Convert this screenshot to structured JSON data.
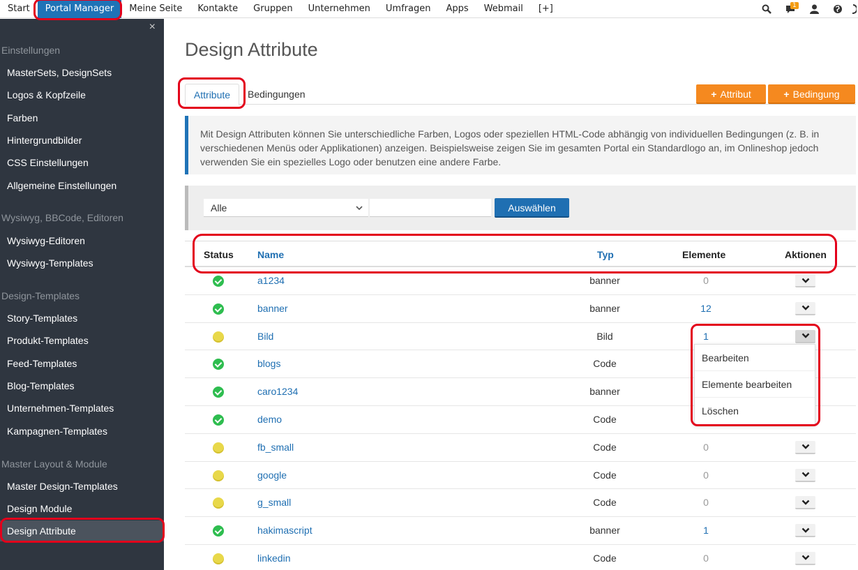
{
  "topnav": {
    "items": [
      "Start",
      "Portal Manager",
      "Meine Seite",
      "Kontakte",
      "Gruppen",
      "Unternehmen",
      "Umfragen",
      "Apps",
      "Webmail",
      "[+]"
    ],
    "active_index": 1,
    "notification_count": "1",
    "icons": [
      "search-icon",
      "chat-icon",
      "user-icon",
      "globe-icon",
      "power-icon"
    ]
  },
  "sidebar": {
    "close_label": "×",
    "sections": [
      {
        "heading": "Einstellungen",
        "items": [
          "MasterSets, DesignSets",
          "Logos & Kopfzeile",
          "Farben",
          "Hintergrundbilder",
          "CSS Einstellungen",
          "Allgemeine Einstellungen"
        ]
      },
      {
        "heading": "Wysiwyg, BBCode, Editoren",
        "items": [
          "Wysiwyg-Editoren",
          "Wysiwyg-Templates"
        ]
      },
      {
        "heading": "Design-Templates",
        "items": [
          "Story-Templates",
          "Produkt-Templates",
          "Feed-Templates",
          "Blog-Templates",
          "Unternehmen-Templates",
          "Kampagnen-Templates"
        ]
      },
      {
        "heading": "Master Layout & Module",
        "items": [
          "Master Design-Templates",
          "Design Module",
          "Design Attribute"
        ]
      }
    ],
    "active_item": "Design Attribute"
  },
  "main": {
    "title": "Design Attribute",
    "tabs": [
      "Attribute",
      "Bedingungen"
    ],
    "buttons": {
      "add_attribute": "Attribut",
      "add_condition": "Bedingung"
    },
    "info_text": "Mit Design Attributen können Sie unterschiedliche Farben, Logos oder speziellen HTML-Code abhängig von individuellen Bedingungen (z. B. in verschiedenen Menüs oder Applikationen) anzeigen. Beispielsweise zeigen Sie im gesamten Portal ein Standardlogo an, im Onlineshop jedoch verwenden Sie ein spezielles Logo oder benutzen eine andere Farbe.",
    "filter": {
      "select_value": "Alle",
      "text_value": "",
      "submit_label": "Auswählen"
    }
  },
  "table": {
    "headers": {
      "status": "Status",
      "name": "Name",
      "typ": "Typ",
      "elemente": "Elemente",
      "aktionen": "Aktionen"
    },
    "rows": [
      {
        "status": "active",
        "name": "a1234",
        "typ": "banner",
        "elemente": "0"
      },
      {
        "status": "active",
        "name": "banner",
        "typ": "banner",
        "elemente": "12"
      },
      {
        "status": "inactive",
        "name": "Bild",
        "typ": "Bild",
        "elemente": "1"
      },
      {
        "status": "active",
        "name": "blogs",
        "typ": "Code",
        "elemente": ""
      },
      {
        "status": "active",
        "name": "caro1234",
        "typ": "banner",
        "elemente": ""
      },
      {
        "status": "active",
        "name": "demo",
        "typ": "Code",
        "elemente": ""
      },
      {
        "status": "inactive",
        "name": "fb_small",
        "typ": "Code",
        "elemente": "0"
      },
      {
        "status": "inactive",
        "name": "google",
        "typ": "Code",
        "elemente": "0"
      },
      {
        "status": "inactive",
        "name": "g_small",
        "typ": "Code",
        "elemente": "0"
      },
      {
        "status": "active",
        "name": "hakimascript",
        "typ": "banner",
        "elemente": "1"
      },
      {
        "status": "inactive",
        "name": "linkedin",
        "typ": "Code",
        "elemente": "0"
      }
    ],
    "open_actions_row": 2,
    "actions_menu": [
      "Bearbeiten",
      "Elemente bearbeiten",
      "Löschen"
    ]
  },
  "colors": {
    "accent": "#1f73b7",
    "orange": "#f5891f",
    "sidebar_bg": "#2f3640",
    "highlight": "#e3001b",
    "ok": "#2ebd4f",
    "warn": "#e8d84a"
  }
}
